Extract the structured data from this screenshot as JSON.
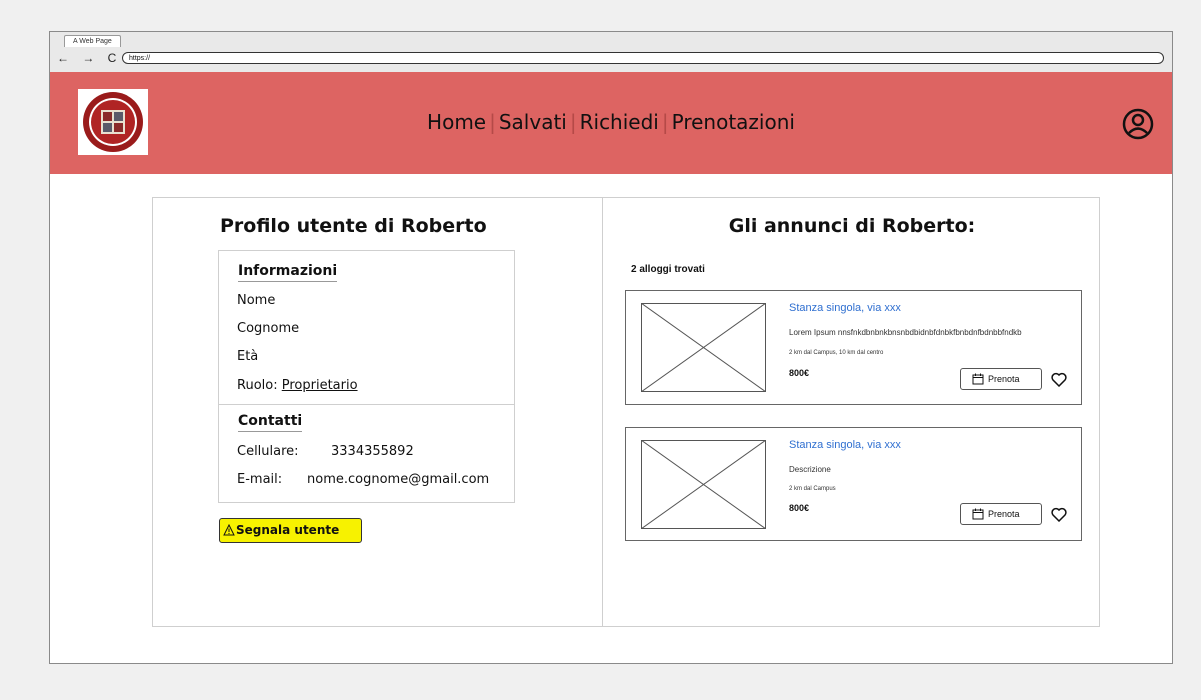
{
  "browser": {
    "tab_title": "A Web Page",
    "nav_buttons": "← → C",
    "url": "https://"
  },
  "header": {
    "nav": [
      "Home",
      "Salvati",
      "Richiedi",
      "Prenotazioni"
    ],
    "accent_color": "#dd6462"
  },
  "profile": {
    "title": "Profilo utente di Roberto",
    "info_section": "Informazioni",
    "fields": [
      "Nome",
      "Cognome",
      "Età"
    ],
    "role_label": "Ruolo: ",
    "role_value": "Proprietario",
    "contacts_section": "Contatti",
    "phone_label": "Cellulare:",
    "phone_value": "3334355892",
    "email_label": "E-mail:",
    "email_value": "nome.cognome@gmail.com",
    "report_button": "Segnala utente"
  },
  "ads": {
    "title": "Gli annunci di Roberto:",
    "count_text": "2 alloggi trovati",
    "items": [
      {
        "title": "Stanza singola, via xxx",
        "description": "Lorem Ipsum nnsfnkdbnbnkbnsnbdbidnbfdnbkfbnbdnfbdnbbfndkb",
        "distance": "2 km dal Campus, 10 km dal centro",
        "price": "800€",
        "book_label": "Prenota"
      },
      {
        "title": "Stanza singola, via xxx",
        "description": "Descrizione",
        "distance": "2 km dal Campus",
        "price": "800€",
        "book_label": "Prenota"
      }
    ]
  }
}
